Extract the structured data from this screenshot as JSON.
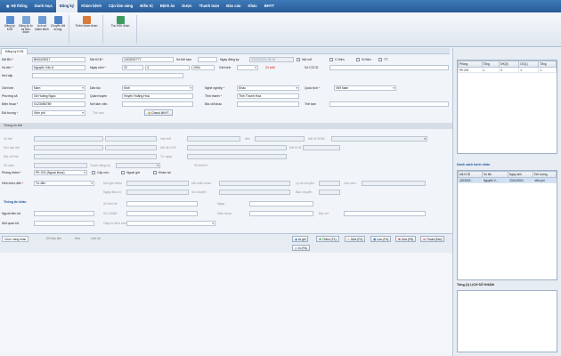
{
  "menu": [
    "Hệ thống",
    "Danh mục",
    "Đăng ký",
    "Khám bệnh",
    "Cận lâm sàng",
    "Điều trị",
    "Bệnh án",
    "Dược",
    "Thanh toán",
    "Báo cáo",
    "Khác",
    "BHYT"
  ],
  "ribbon": {
    "group1": [
      "Đăng ký KCB",
      "Đăng ký từ xa theo đoàn",
      "Lịch sử khám bệnh",
      "Chuyển đối tượng"
    ],
    "group2": [
      "Thêm khám đoàn"
    ],
    "group3": [
      "Thu KSK đoàn"
    ]
  },
  "tab": "Đăng ký KCB",
  "form": {
    "ma_bn_label": "Mã BN",
    "ma_bn": "BN0425317",
    "ma_kcb_label": "Mã KCB",
    "ma_kcb": "2403002777",
    "so_the_label": "Số thẻ tạm",
    "so_the": "",
    "ngay_dk_label": "Ngày đăng ký",
    "ngay_dk": "22/04/2024 08:16",
    "noi_mo": "Nội mổ",
    "chk_c": "C.Hiện",
    "chk_n": "N.Hiện",
    "chk_tt": "T.T",
    "ho_ten_label": "Họ tên",
    "ho_ten": "Nguyễn Văn A",
    "ngay_sinh_label": "Ngày sinh",
    "ngay_sinh_d": "22",
    "ngay_sinh_m": "4",
    "ngay_sinh_y": "1904",
    "gioi_tinh_label": "Giới tính",
    "tuoi": "21 tuổi",
    "so_cccd_label": "Số CCCD",
    "so_cccd": "",
    "noi_cap_label": "Nơi cấp",
    "dan_toc_label": "Dân tộc",
    "dan_toc": "Kinh",
    "gioi_tinh2_label": "Giới tính",
    "gioi_tinh2": "Nam",
    "nghe_nghiep_label": "Nghề nghiệp",
    "nghe_nghiep": "Khác",
    "quoc_tich_label": "Quốc tịch",
    "quoc_tich": "Việt Nam",
    "phuong_xa_label": "Phường xã",
    "phuong_xa": "Xã Hoằng Ngọc",
    "quan_huyen_label": "Quận huyện",
    "quan_huyen": "Huyện Hoằng Hóa",
    "tinh_label": "Tỉnh thành",
    "tinh": "Tỉnh Thanh Hóa",
    "dien_thoai_label": "Điện thoại",
    "dien_thoai": "0123456789",
    "noi_lam_viec_label": "Nơi làm việc",
    "dia_chi_label": "Địa chỉ khác",
    "the_tam_label": "Thẻ tạm",
    "doi_tuong_label": "Đối tượng",
    "doi_tuong": "Viện phí",
    "the_bhyt_btn": "Check BHYT",
    "thong_tin_the": "Thông tin thẻ",
    "so_the2_label": "Số thẻ",
    "han_the_label": "Hạn thẻ",
    "den_label": "đến",
    "ma_kcbbd_label": "Mã KCB BĐ",
    "noi_cap_the_label": "Nơi cấp thẻ",
    "ma_dk_label": "Mã đk KCB",
    "mkcb_label": "Mã KCB",
    "dia_chi_the_label": "Địa chỉ thẻ",
    "tu_ngay_label": "Từ ngày",
    "so_nam_label": "Số năm",
    "tuyen_label": "Tuyến đăng ký",
    "so_bhxh_label": "Số BHXH",
    "phong_kham_label": "Phòng khám",
    "phong_kham": "PK 201 (Ngoại khoa)",
    "cap_cuu": "Cấp cứu",
    "ngoai_gio": "Ngoài giờ",
    "kham_lai": "Khám lại",
    "hinh_thuc_label": "Hình thức đến",
    "hinh_thuc": "Tự đến",
    "noi_gioi_thieu_label": "Nơi giới thiệu",
    "ma_chuyen_label": "Mã chẩn đoán",
    "ly_do_label": "Lý do chuyển",
    "lien_don_label": "Liên đơn",
    "ngay_dieu_tri_label": "Ngày điều trị",
    "so_chuyen_label": "Số chuyển",
    "chuyen_la_label": "Bảo chuyển",
    "thong_tin_khac": "Thông tin khác",
    "nguoi_lien_he_label": "Người liên hệ",
    "so_lien_he_label": "Số liên hệ",
    "ngay_label": "Ngày",
    "so_cmnd_label": "Số CMND",
    "dien_thoai2_label": "Điện thoại",
    "dia_chi2_label": "Địa chỉ",
    "moi_quan_he_label": "Mối quan hệ",
    "giay_to_label": "Giấy tờ đính kèm"
  },
  "subtabs": [
    "Chức năng khác",
    "DS tiếp đón",
    "Hẹn",
    "Lịch sử"
  ],
  "actions": [
    "Ai ghi",
    "Thêm (F1)",
    "Sửa (F2)",
    "Lưu (F4)",
    "Xóa (F8)",
    "Thoát (Esc)",
    "In (F6)"
  ],
  "right_table": {
    "headers": [
      "Phòng",
      "Tổng",
      "ĐK(0)",
      "CK(1)",
      "Tổng"
    ],
    "rows": [
      [
        "PK 201",
        "1",
        "0",
        "1",
        "1"
      ]
    ]
  },
  "ds_title": "Danh sách bệnh nhân",
  "ds_table": {
    "headers": [
      "Mã KCB",
      "Họ tên",
      "Ngày sinh",
      "Đối tượng"
    ],
    "rows": [
      [
        "2403002...",
        "Nguyễn V...",
        "22/04/2001",
        "Viện phí"
      ]
    ]
  },
  "lich_su_title": "Tổng (1) LỊCH SỬ KHÁM"
}
